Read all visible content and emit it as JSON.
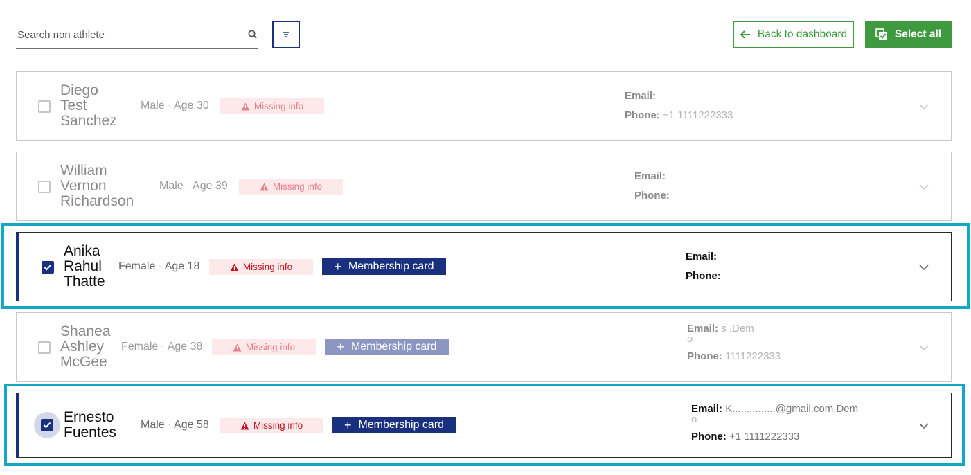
{
  "toolbar": {
    "search_placeholder": "Search non athlete",
    "back_label": "Back to dashboard",
    "select_all_label": "Select all",
    "icons": {
      "search": "search-icon",
      "filter": "filter-icon",
      "back": "arrow-left-icon",
      "select_all": "select-all-icon"
    }
  },
  "colors": {
    "primary": "#19307e",
    "green": "#3f9a3f",
    "missing_bg": "#fde8ea",
    "missing_text": "#c4121f",
    "highlight": "#13a7c7"
  },
  "people": [
    {
      "name_lines": [
        "Diego",
        "Test",
        "Sanchez"
      ],
      "gender": "Male",
      "age": "Age 30",
      "missing_label": "Missing info",
      "membership_label": null,
      "email_label": "Email:",
      "email": "",
      "phone_label": "Phone:",
      "phone": "+1 1111222333",
      "selected": false
    },
    {
      "name_lines": [
        "William",
        "Vernon",
        "Richardson"
      ],
      "gender": "Male",
      "age": "Age 39",
      "missing_label": "Missing info",
      "membership_label": null,
      "email_label": "Email:",
      "email": "",
      "phone_label": "Phone:",
      "phone": "",
      "selected": false
    },
    {
      "name_lines": [
        "Anika",
        "Rahul",
        "Thatte"
      ],
      "gender": "Female",
      "age": "Age 18",
      "missing_label": "Missing info",
      "membership_label": "Membership card",
      "email_label": "Email:",
      "email": "",
      "phone_label": "Phone:",
      "phone": "",
      "selected": true
    },
    {
      "name_lines": [
        "Shanea",
        "Ashley",
        "McGee"
      ],
      "gender": "Female",
      "age": "Age 38",
      "missing_label": "Missing info",
      "membership_label": "Membership card",
      "email_label": "Email:",
      "email": "s                                          .Dem",
      "email_wrap": "o",
      "phone_label": "Phone:",
      "phone": "1111222333",
      "selected": false
    },
    {
      "name_lines": [
        "Ernesto",
        "Fuentes"
      ],
      "gender": "Male",
      "age": "Age 58",
      "missing_label": "Missing info",
      "membership_label": "Membership card",
      "email_label": "Email:",
      "email": "K...............@gmail.com.Dem",
      "email_wrap": "o",
      "phone_label": "Phone:",
      "phone": "+1 1111222333",
      "selected": true
    }
  ]
}
